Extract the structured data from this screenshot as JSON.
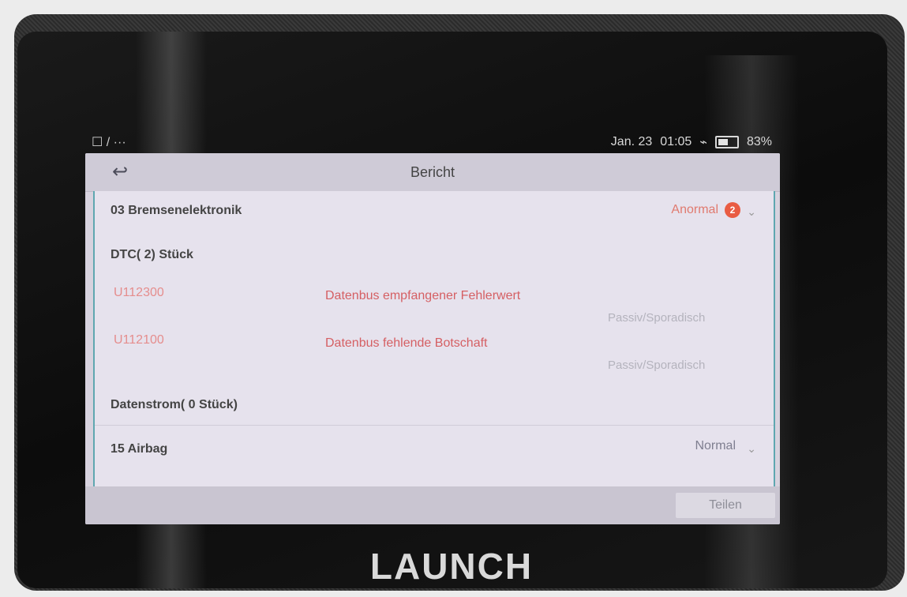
{
  "status_bar": {
    "left_text": "☐ / ···",
    "date": "Jan. 23",
    "time": "01:05",
    "battery_pct": "83%"
  },
  "screen": {
    "title": "Bericht",
    "back_icon": "back-arrow-icon",
    "module_1": {
      "name": "03 Bremsenelektronik",
      "status": "Anormal",
      "badge": "2"
    },
    "dtc_header": "DTC( 2) Stück",
    "dtcs": [
      {
        "code": "U112300",
        "description": "Datenbus empfangener Fehlerwert",
        "state": "Passiv/Sporadisch"
      },
      {
        "code": "U112100",
        "description": "Datenbus fehlende Botschaft",
        "state": "Passiv/Sporadisch"
      }
    ],
    "datastream_header": "Datenstrom( 0 Stück)",
    "module_2": {
      "name": "15 Airbag",
      "status": "Normal"
    },
    "share_button": "Teilen"
  },
  "brand": {
    "logo_text": "LAUNCH"
  }
}
